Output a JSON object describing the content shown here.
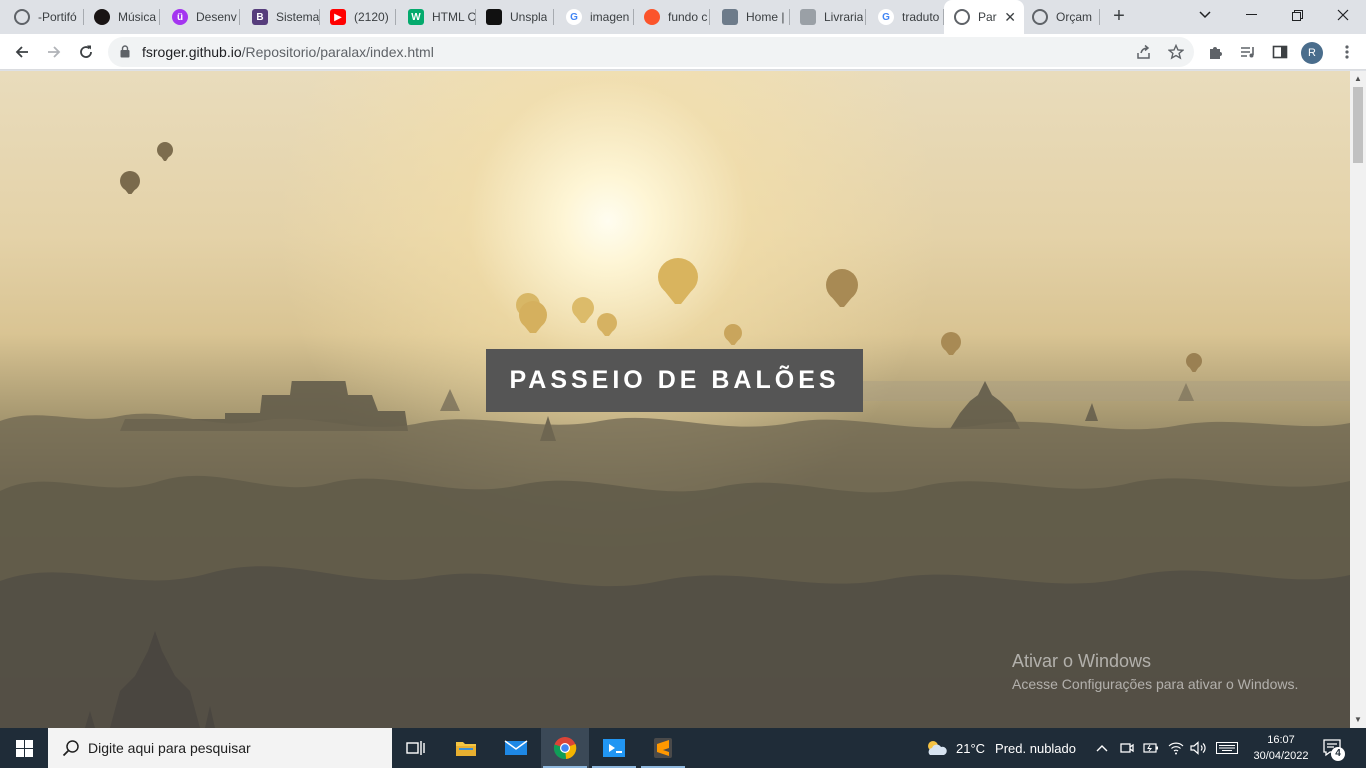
{
  "browser": {
    "tabs": [
      {
        "label": "-Portifó",
        "icon": "globe-icon",
        "color": "#5f6368"
      },
      {
        "label": "Música",
        "icon": "spotify-icon",
        "color": "#191414"
      },
      {
        "label": "Desenv",
        "icon": "udemy-icon",
        "color": "#a435f0"
      },
      {
        "label": "Sistema",
        "icon": "bootstrap-icon",
        "color": "#563d7c"
      },
      {
        "label": "(2120)",
        "icon": "youtube-icon",
        "color": "#ff0000"
      },
      {
        "label": "HTML C",
        "icon": "w3schools-icon",
        "color": "#04aa6d"
      },
      {
        "label": "Unspla",
        "icon": "unsplash-icon",
        "color": "#111111"
      },
      {
        "label": "imagen",
        "icon": "google-icon",
        "color": "#4285f4"
      },
      {
        "label": "fundo c",
        "icon": "brave-icon",
        "color": "#fb542b"
      },
      {
        "label": "Home |",
        "icon": "site-thumbnail-icon",
        "color": "#6d7b8a"
      },
      {
        "label": "Livraria",
        "icon": "document-icon",
        "color": "#9aa0a6"
      },
      {
        "label": "traduto",
        "icon": "google-icon",
        "color": "#4285f4"
      },
      {
        "label": "Par",
        "icon": "globe-icon",
        "color": "#5f6368",
        "active": true
      },
      {
        "label": "Orçam",
        "icon": "globe-icon",
        "color": "#5f6368"
      }
    ],
    "url_host": "fsroger.github.io",
    "url_path": "/Repositorio/paralax/index.html",
    "profile_initial": "R"
  },
  "page": {
    "hero_title": "PASSEIO DE BALÕES"
  },
  "watermark": {
    "line1": "Ativar o Windows",
    "line2": "Acesse Configurações para ativar o Windows."
  },
  "taskbar": {
    "search_placeholder": "Digite aqui para pesquisar",
    "weather_temp": "21°C",
    "weather_desc": "Pred. nublado",
    "time": "16:07",
    "date": "30/04/2022",
    "notification_count": "4"
  },
  "colors": {
    "hero_box": "#555555",
    "taskbar": "#1f2c38",
    "tabstrip": "#dee1e6"
  }
}
